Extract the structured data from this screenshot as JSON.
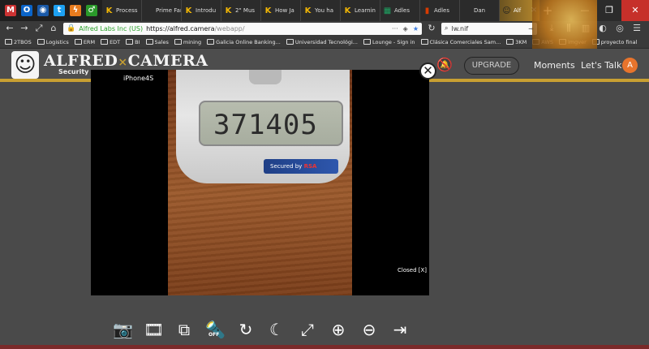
{
  "browser": {
    "pinned_icons": [
      "gmail-icon",
      "outlook-icon",
      "globe-icon",
      "twitter-icon",
      "bolt-icon",
      "gender-icon"
    ],
    "tabs": [
      {
        "label": "Process",
        "icon": "K",
        "color": "#f2b705"
      },
      {
        "label": "Prime Fantas",
        "icon": "",
        "color": "#333"
      },
      {
        "label": "Introdu",
        "icon": "K",
        "color": "#f2b705"
      },
      {
        "label": "2\" Mus",
        "icon": "K",
        "color": "#f2b705"
      },
      {
        "label": "How Ja",
        "icon": "K",
        "color": "#f2b705"
      },
      {
        "label": "You ha",
        "icon": "K",
        "color": "#f2b705"
      },
      {
        "label": "Learnin",
        "icon": "K",
        "color": "#f2b705"
      },
      {
        "label": "Adles",
        "icon": "▦",
        "color": "#1ea362"
      },
      {
        "label": "Adles",
        "icon": "▮",
        "color": "#d83b01"
      },
      {
        "label": "Dan",
        "icon": "",
        "color": "#333"
      }
    ],
    "active_tab": {
      "label": "Alf",
      "close": "✕"
    },
    "new_tab": "+",
    "window_buttons": [
      "—",
      "❐",
      "✕"
    ],
    "url": {
      "org": "Alfred Labs Inc (US)",
      "host": "https://alfred.camera",
      "path": "/webapp/"
    },
    "search_value": "lw.nif",
    "bookmarks": [
      "2TBOS",
      "Logistics",
      "ERM",
      "EDT",
      "BI",
      "Sales",
      "mining",
      "Galicia Online Banking...",
      "Universidad Tecnológi...",
      "Lounge - Sign in",
      "Clásica Comerciales Sam...",
      "3KM",
      "AWS",
      "imgver",
      "proyecto final"
    ]
  },
  "app": {
    "brand_left": "ALFRED",
    "brand_x": "×",
    "brand_right": "CAMERA",
    "brand_sub": "Security",
    "upgrade_label": "UPGRADE",
    "moments_label": "Moments",
    "talk_label": "Let's Talk",
    "avatar_letter": "A"
  },
  "viewer": {
    "camera_name": "iPhone4S",
    "close_symbol": "✕",
    "caption": "Closed [X]",
    "token_reading": "371405",
    "badge_text": "Secured by",
    "badge_brand": "RSA"
  },
  "controls": [
    {
      "name": "snapshot-icon",
      "glyph": "📷"
    },
    {
      "name": "record-icon",
      "glyph": "🎞"
    },
    {
      "name": "switch-camera-icon",
      "glyph": "⧉"
    },
    {
      "name": "flashlight-off-icon",
      "glyph": "🔦",
      "sub": "OFF"
    },
    {
      "name": "rotate-icon",
      "glyph": "↻"
    },
    {
      "name": "night-mode-icon",
      "glyph": "☾"
    },
    {
      "name": "fullscreen-icon",
      "glyph": "⤢"
    },
    {
      "name": "zoom-in-icon",
      "glyph": "⊕"
    },
    {
      "name": "zoom-out-icon",
      "glyph": "⊖"
    },
    {
      "name": "exit-icon",
      "glyph": "⇥"
    }
  ]
}
